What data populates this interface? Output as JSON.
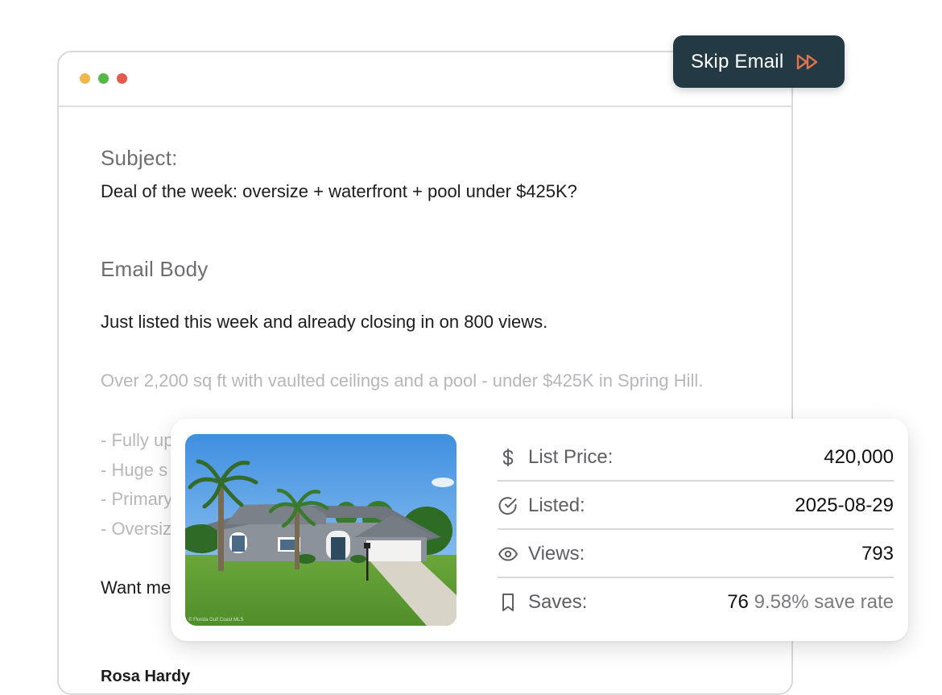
{
  "window": {
    "controls": [
      "yellow",
      "green",
      "red"
    ]
  },
  "email": {
    "subject_label": "Subject:",
    "subject": "Deal of the week: oversize + waterfront + pool under $425K?",
    "body_label": "Email Body",
    "body_line1": "Just listed this week and already closing in on 800 views.",
    "body_line2": "Over 2,200 sq ft with vaulted ceilings and a pool - under $425K in Spring Hill.",
    "bullets": [
      "- Fully up",
      "- Huge s",
      "- Primary",
      "- Oversiz"
    ],
    "closing": "Want me",
    "signature": "Rosa Hardy"
  },
  "skip_button": {
    "label": "Skip Email",
    "icon": "fast-forward-icon",
    "accent": "#e0734f",
    "background": "#233a44"
  },
  "listing": {
    "photo_credit": "© Florida Gulf Coast MLS",
    "stats": {
      "price_label": "List Price:",
      "price_value": "420,000",
      "listed_label": "Listed:",
      "listed_value": "2025-08-29",
      "views_label": "Views:",
      "views_value": "793",
      "saves_label": "Saves:",
      "saves_value": "76",
      "saves_rate": "9.58% save rate"
    },
    "icons": [
      "dollar-icon",
      "check-circle-icon",
      "eye-icon",
      "bookmark-icon"
    ]
  }
}
